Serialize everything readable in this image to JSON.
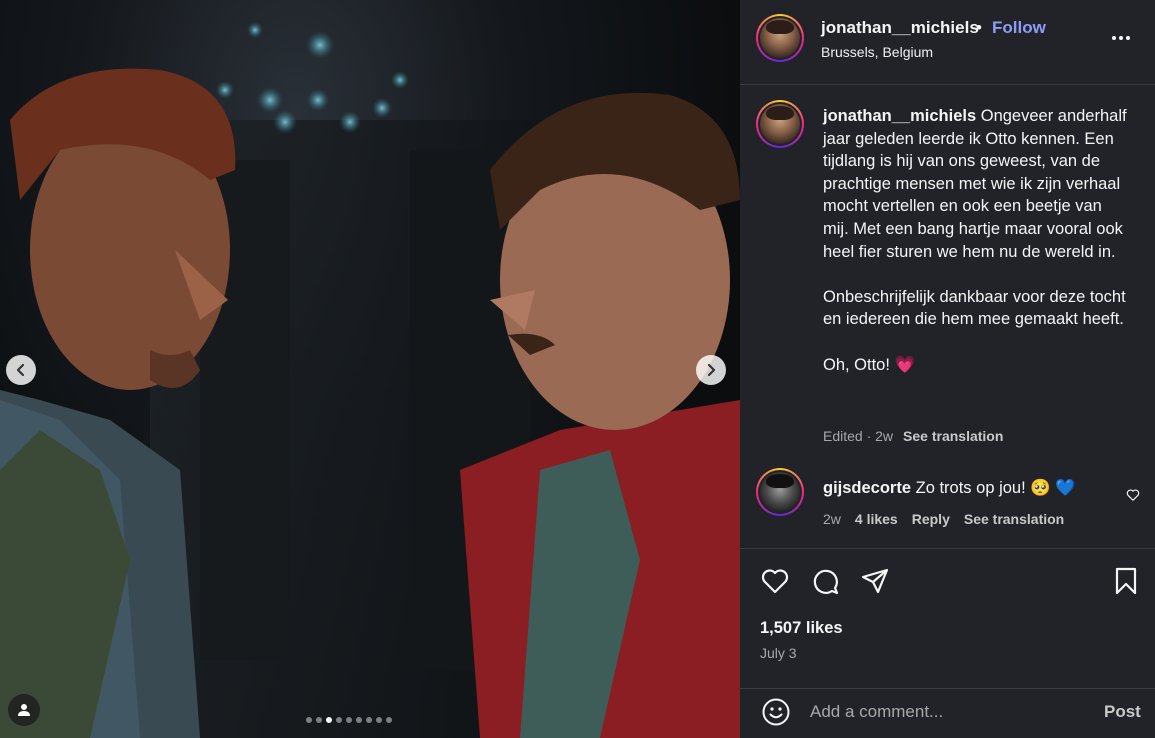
{
  "post": {
    "username": "jonathan__michiels",
    "separator": "•",
    "follow_label": "Follow",
    "location": "Brussels, Belgium"
  },
  "caption": {
    "username": "jonathan__michiels",
    "text": "Ongeveer anderhalf jaar geleden leerde ik Otto kennen. Een tijdlang is hij van ons geweest, van de prachtige mensen met wie ik zijn verhaal mocht vertellen en ook een beetje van mij. Met een bang hartje maar vooral ook heel fier sturen we hem nu de wereld in.\n\nOnbeschrijfelijk dankbaar voor deze tocht en iedereen die hem mee gemaakt heeft.\n\nOh, Otto! ",
    "heart": "💗",
    "edited": "Edited · 2w",
    "see_translation": "See translation"
  },
  "comment": {
    "username": "gijsdecorte",
    "text": "Zo trots op jou! 🥺 ",
    "heart": "💙",
    "age": "2w",
    "likes": "4 likes",
    "reply": "Reply",
    "see_translation": "See translation"
  },
  "actions": {
    "icons": [
      "heart-icon",
      "comment-icon",
      "share-icon",
      "bookmark-icon"
    ]
  },
  "stats": {
    "likes": "1,507 likes",
    "date": "July 3"
  },
  "composer": {
    "placeholder": "Add a comment...",
    "post_label": "Post"
  },
  "carousel": {
    "slide_count": 9,
    "active_index": 2
  },
  "colors": {
    "follow": "#8b9df5",
    "panel_bg": "#212328",
    "muted": "#a8a8a8"
  }
}
